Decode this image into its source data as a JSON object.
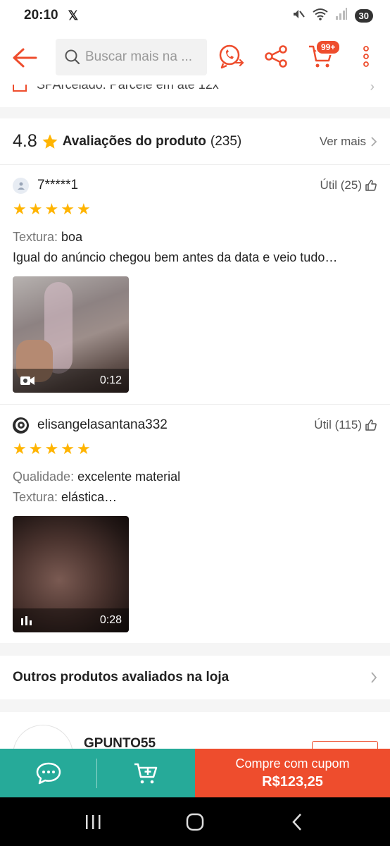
{
  "status_bar": {
    "time": "20:10",
    "x_glyph": "𝕏",
    "battery": "30"
  },
  "top_nav": {
    "search_placeholder": "Buscar mais na ...",
    "cart_badge": "99+"
  },
  "partial_strip": {
    "text": "SPArcelado: Parcele em até 12x"
  },
  "reviews": {
    "rating": "4.8",
    "title": "Avaliações do produto",
    "count": "(235)",
    "see_more": "Ver mais",
    "items": [
      {
        "username": "7*****1",
        "helpful": "Útil (25)",
        "stars": 5,
        "attributes": [
          {
            "key": "Textura:",
            "value": "boa"
          }
        ],
        "comment": "Igual do anúncio chegou bem antes da data e veio tudo…",
        "media_duration": "0:12"
      },
      {
        "username": "elisangelasantana332",
        "helpful": "Útil (115)",
        "stars": 5,
        "attributes": [
          {
            "key": "Qualidade:",
            "value": "excelente material"
          },
          {
            "key": "Textura:",
            "value": "elástica…"
          }
        ],
        "media_duration": "0:28"
      }
    ]
  },
  "other_products": {
    "label": "Outros produtos avaliados na loja"
  },
  "shop": {
    "name": "GPUNTO55"
  },
  "bottom_bar": {
    "buy_label": "Compre com cupom",
    "buy_price": "R$123,25"
  },
  "colors": {
    "accent": "#ee4d2d",
    "teal": "#26aa99",
    "star": "#ffb400"
  }
}
